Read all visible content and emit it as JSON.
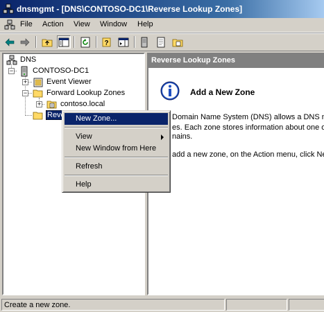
{
  "window": {
    "title": "dnsmgmt - [DNS\\CONTOSO-DC1\\Reverse Lookup Zones]"
  },
  "menubar": {
    "items": [
      "File",
      "Action",
      "View",
      "Window",
      "Help"
    ]
  },
  "tree": {
    "root": "DNS",
    "server": "CONTOSO-DC1",
    "event_viewer": "Event Viewer",
    "forward_zones": "Forward Lookup Zones",
    "contoso": "contoso.local",
    "reverse_partial": "Reve"
  },
  "context_menu": {
    "items": [
      "New Zone...",
      "View",
      "New Window from Here",
      "Refresh",
      "Help"
    ],
    "selected": "New Zone..."
  },
  "right_pane": {
    "header": "Reverse Lookup Zones",
    "heading": "Add a New Zone",
    "line1": "Domain Name System (DNS) allows a DNS nam",
    "line2": "es. Each zone stores information about one or",
    "line3": "nains.",
    "line4": "add a new zone, on the Action menu, click New"
  },
  "status": {
    "text": "Create a new zone."
  },
  "colors": {
    "title_start": "#0a246a",
    "title_end": "#a6caf0",
    "highlight": "#0a246a",
    "pane_header": "#808080"
  }
}
